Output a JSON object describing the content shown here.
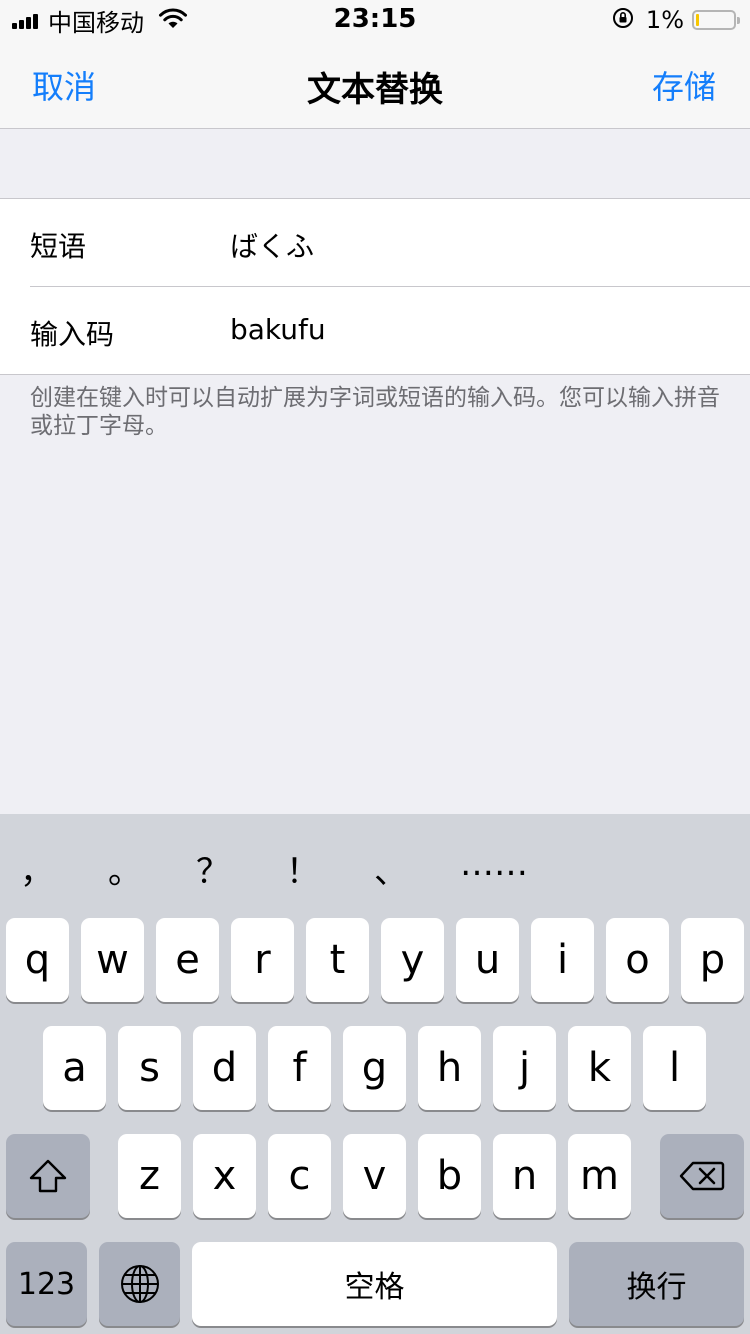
{
  "status_bar": {
    "carrier": "中国移动",
    "time": "23:15",
    "battery_percent": "1%",
    "battery_level": 0.01,
    "icons": [
      "signal-icon",
      "wifi-icon",
      "rotation-lock-icon",
      "battery-icon"
    ]
  },
  "nav": {
    "cancel": "取消",
    "title": "文本替换",
    "save": "存储"
  },
  "form": {
    "phrase_label": "短语",
    "phrase_value": "ばくふ",
    "shortcut_label": "输入码",
    "shortcut_value": "bakufu",
    "hint": "创建在键入时可以自动扩展为字词或短语的输入码。您可以输入拼音或拉丁字母。"
  },
  "keyboard": {
    "candidates": [
      "，",
      "。",
      "？",
      "！",
      "、",
      "……"
    ],
    "row1": [
      "q",
      "w",
      "e",
      "r",
      "t",
      "y",
      "u",
      "i",
      "o",
      "p"
    ],
    "row2": [
      "a",
      "s",
      "d",
      "f",
      "g",
      "h",
      "j",
      "k",
      "l"
    ],
    "row3": [
      "z",
      "x",
      "c",
      "v",
      "b",
      "n",
      "m"
    ],
    "numbers_key": "123",
    "space_key": "空格",
    "return_key": "换行",
    "icons": [
      "shift-icon",
      "delete-icon",
      "globe-icon"
    ]
  },
  "colors": {
    "accent": "#147efb",
    "background": "#efeff4",
    "keyboard_bg": "#d1d4da",
    "dark_key": "#abb0bc",
    "battery_low": "#f7c600"
  }
}
